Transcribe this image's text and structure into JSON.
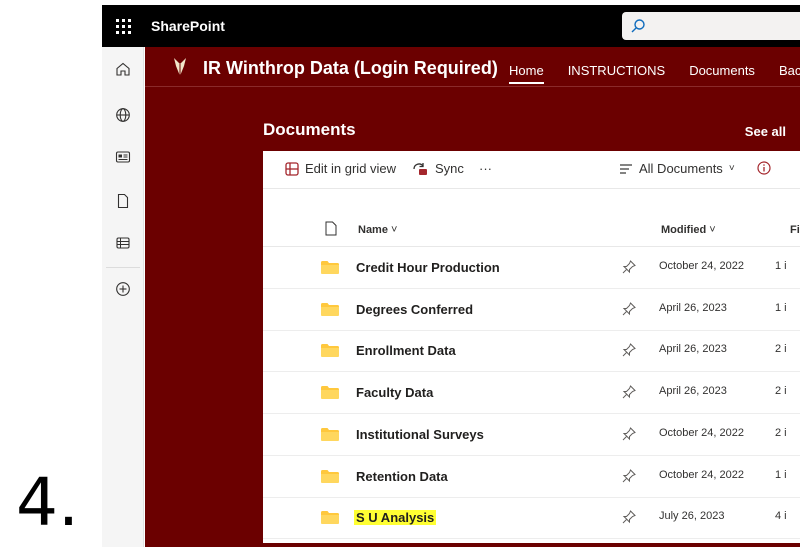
{
  "step_label": "4.",
  "suite": {
    "app_name": "SharePoint"
  },
  "site": {
    "title": "IR Winthrop Data (Login Required)",
    "nav": [
      "Home",
      "INSTRUCTIONS",
      "Documents",
      "Back"
    ],
    "nav_active": "Home"
  },
  "library": {
    "heading": "Documents",
    "see_all": "See all",
    "commands": {
      "edit_grid": "Edit in grid view",
      "sync": "Sync",
      "more": "···",
      "view": "All Documents",
      "view_chevron": "˅"
    },
    "columns": {
      "name": "Name",
      "modified": "Modified",
      "extra": "Fi"
    },
    "rows": [
      {
        "name": "Credit Hour Production",
        "modified": "October 24, 2022",
        "extra": "1 i"
      },
      {
        "name": "Degrees Conferred",
        "modified": "April 26, 2023",
        "extra": "1 i"
      },
      {
        "name": "Enrollment Data",
        "modified": "April 26, 2023",
        "extra": "2 i"
      },
      {
        "name": "Faculty Data",
        "modified": "April 26, 2023",
        "extra": "2 i"
      },
      {
        "name": "Institutional Surveys",
        "modified": "October 24, 2022",
        "extra": "2 i"
      },
      {
        "name": "Retention Data",
        "modified": "October 24, 2022",
        "extra": "1 i"
      },
      {
        "name": "S U Analysis",
        "modified": "July 26, 2023",
        "extra": "4 i",
        "highlighted": true
      }
    ]
  },
  "colors": {
    "suite_bar": "#000000",
    "site_background": "#6b0000",
    "folder": "#ffc83d",
    "highlight": "#ffff33",
    "accent_edit": "#a4262c"
  },
  "icons": [
    "waffle-icon",
    "search-icon",
    "home-icon",
    "globe-icon",
    "news-icon",
    "file-icon",
    "list-icon",
    "add-icon",
    "grid-edit-icon",
    "sync-icon",
    "filter-icon",
    "info-icon",
    "folder-icon",
    "pin-icon"
  ]
}
